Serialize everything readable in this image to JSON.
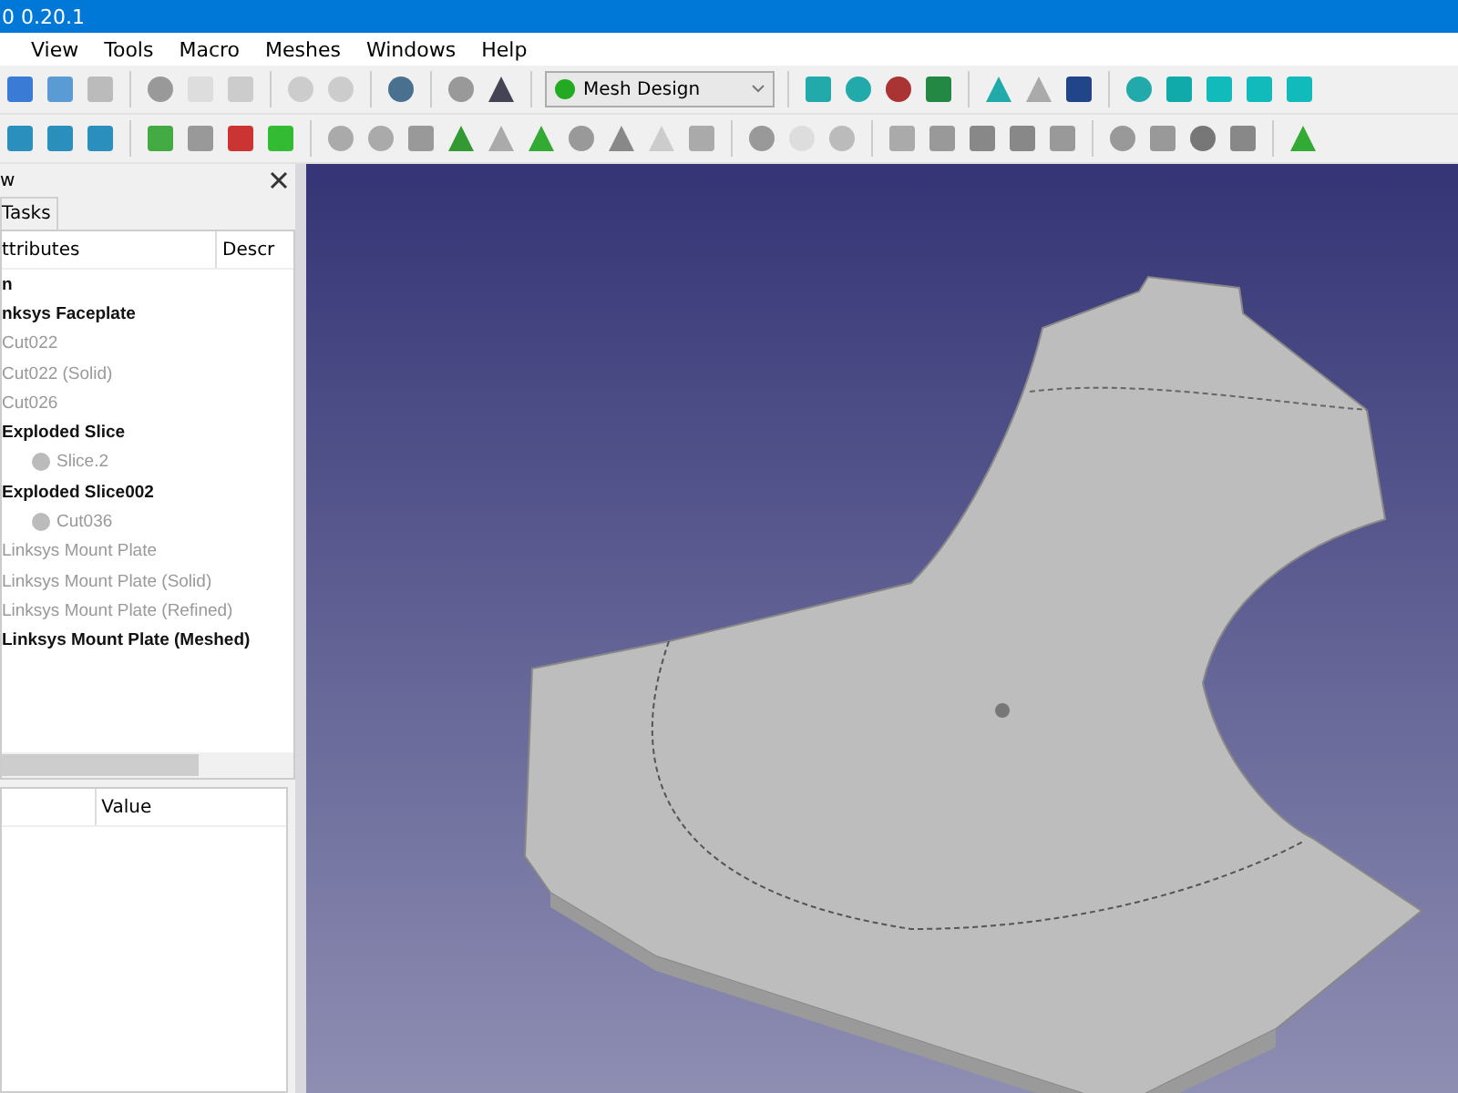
{
  "window": {
    "title": "0 0.20.1"
  },
  "menu": [
    "View",
    "Tools",
    "Macro",
    "Meshes",
    "Windows",
    "Help"
  ],
  "workbench": {
    "label": "Mesh Design"
  },
  "combo_view": {
    "title": "w",
    "tabs": [
      {
        "label": "Tasks",
        "selected": false
      }
    ],
    "tree": {
      "columns": [
        "ttributes",
        "Descr"
      ],
      "items": [
        {
          "label": "n",
          "visible": true
        },
        {
          "label": "nksys Faceplate",
          "visible": true
        },
        {
          "label": "Cut022",
          "visible": false
        },
        {
          "label": "Cut022 (Solid)",
          "visible": false
        },
        {
          "label": "Cut026",
          "visible": false
        },
        {
          "label": "Exploded Slice",
          "visible": true,
          "children": [
            {
              "label": "Slice.2",
              "visible": false
            }
          ]
        },
        {
          "label": "Exploded Slice002",
          "visible": true,
          "children": [
            {
              "label": "Cut036",
              "visible": false
            }
          ]
        },
        {
          "label": "Linksys Mount Plate",
          "visible": false
        },
        {
          "label": "Linksys Mount Plate (Solid)",
          "visible": false
        },
        {
          "label": "Linksys Mount Plate (Refined)",
          "visible": false
        },
        {
          "label": "Linksys Mount Plate (Meshed)",
          "visible": true
        }
      ]
    },
    "properties": {
      "columns": [
        "Value"
      ]
    }
  }
}
